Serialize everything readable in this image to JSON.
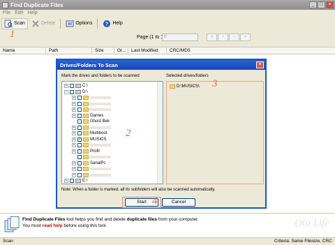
{
  "window": {
    "title": "Find Duplicate Files"
  },
  "menu": [
    "File",
    "Edit",
    "Help"
  ],
  "toolbar": {
    "scan_label": "Scan",
    "delete_label": "Delete",
    "options_label": "Options",
    "help_label": "Help"
  },
  "annotations": {
    "a1": "1",
    "a2": "2",
    "a3": "3",
    "a4": "4"
  },
  "pagination": {
    "label": "Page (1 to 1)",
    "value": "0"
  },
  "columns": [
    "Name",
    "Path",
    "Size",
    "Gr...",
    "Last Modified",
    "CRC/MD5"
  ],
  "dialog": {
    "title": "Drives/Folders To Scan",
    "left_label": "Mark the drives and folders to be scanned",
    "right_label": "Selected drives/folders",
    "tree": [
      {
        "label": "C:\\",
        "type": "drive",
        "indent": 0,
        "expander": "+",
        "checked": false
      },
      {
        "label": "D:\\",
        "type": "drive",
        "indent": 0,
        "expander": "-",
        "checked": false
      },
      {
        "label": "",
        "type": "folder",
        "indent": 1,
        "expander": "+",
        "checked": false
      },
      {
        "label": "",
        "type": "folder",
        "indent": 1,
        "expander": "+",
        "checked": false
      },
      {
        "label": "",
        "type": "folder",
        "indent": 1,
        "expander": "+",
        "checked": false
      },
      {
        "label": "Games",
        "type": "folder",
        "indent": 1,
        "expander": "+",
        "checked": false
      },
      {
        "label": "Ghost Bek",
        "type": "folder",
        "indent": 1,
        "expander": "",
        "checked": false
      },
      {
        "label": "",
        "type": "folder",
        "indent": 1,
        "expander": "+",
        "checked": false
      },
      {
        "label": "Multiboot",
        "type": "folder",
        "indent": 1,
        "expander": "+",
        "checked": false
      },
      {
        "label": "MUSICS",
        "type": "folder",
        "indent": 1,
        "expander": "+",
        "checked": true
      },
      {
        "label": "",
        "type": "folder",
        "indent": 1,
        "expander": "+",
        "checked": false
      },
      {
        "label": "Profil",
        "type": "folder",
        "indent": 1,
        "expander": "+",
        "checked": false
      },
      {
        "label": "",
        "type": "folder",
        "indent": 1,
        "expander": "",
        "checked": false
      },
      {
        "label": "SanalPc",
        "type": "folder",
        "indent": 1,
        "expander": "+",
        "checked": false
      },
      {
        "label": "",
        "type": "folder",
        "indent": 1,
        "expander": "+",
        "checked": false
      },
      {
        "label": "",
        "type": "folder",
        "indent": 1,
        "expander": "+",
        "checked": false
      },
      {
        "label": "E:\\",
        "type": "drive",
        "indent": 0,
        "expander": "+",
        "checked": false
      }
    ],
    "selected": [
      "D:\\MUSICS\\"
    ],
    "note": "Note: When a folder is marked, all its subfolders will also be scanned automatically.",
    "start_label": "Start",
    "cancel_label": "Cancel"
  },
  "footer": {
    "app_name": "Find Duplicate Files",
    "line1_a": " tool helps you find and delete ",
    "line1_b": "duplicate files",
    "line1_c": " from your computer.",
    "line2_a": "You must ",
    "line2_link": "read help",
    "line2_b": " before using this tool.",
    "watermark": "Oto Life"
  },
  "status": {
    "left": "Scan",
    "right": "Criteria: Same Filesize, CRC"
  }
}
